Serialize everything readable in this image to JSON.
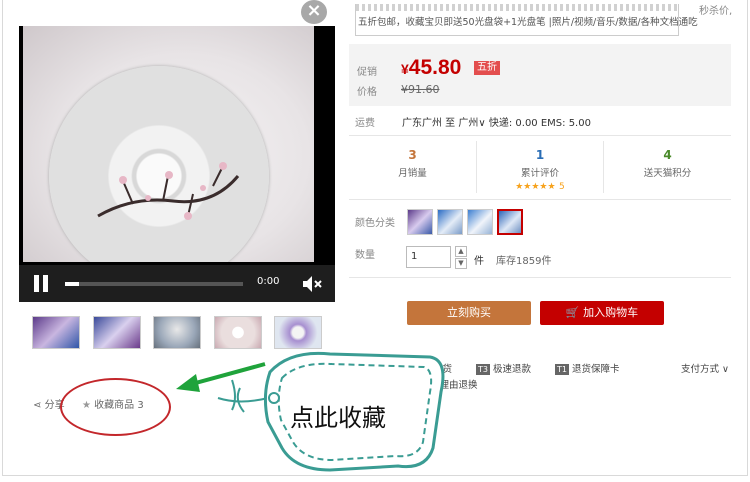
{
  "promo": {
    "text": "五折包邮，收藏宝贝即送50光盘袋+1光盘笔 |照片/视频/音乐/数据/各种文档通吃",
    "right_text": "秒杀价,"
  },
  "close_glyph": "×",
  "video": {
    "time": "0:00",
    "progress": 0.08
  },
  "share_label": "分享",
  "collect_label": "收藏商品",
  "collect_count": "3",
  "price": {
    "promo_label": "促销",
    "price_label": "价格",
    "current": "45.80",
    "currency": "¥",
    "badge": "五折",
    "original": "¥91.60"
  },
  "shipping": {
    "label": "运费",
    "text": "广东广州 至 广州∨ 快递: 0.00 EMS: 5.00"
  },
  "stats": [
    {
      "value": "3",
      "label": "月销量",
      "color": "#c4753b"
    },
    {
      "value": "1",
      "label": "累计评价",
      "color": "#2a6db5",
      "stars": "★★★★★",
      "rating": "5"
    },
    {
      "value": "4",
      "label": "送天猫积分",
      "color": "#4a8a2a"
    }
  ],
  "color_label": "颜色分类",
  "quantity": {
    "label": "数量",
    "value": "1",
    "unit": "件",
    "stock": "库存1859件"
  },
  "buttons": {
    "buy": "立刻购买",
    "cart": "加入购物车"
  },
  "services": [
    {
      "icon": "",
      "text": "按时发货"
    },
    {
      "icon": "T3",
      "text": "极速退款"
    },
    {
      "icon": "T1",
      "text": "退货保障卡"
    }
  ],
  "service_extra": "无理由退换",
  "payment": "支付方式 ∨",
  "annotation": {
    "tag_text": "点此收藏",
    "arrow_color": "#1fa33b",
    "oval_color": "#c3272b",
    "tag_color": "#3a9c93"
  }
}
